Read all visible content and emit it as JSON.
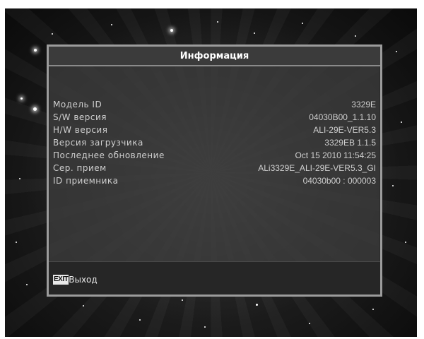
{
  "dialog": {
    "title": "Информация",
    "rows": [
      {
        "label": "Модель ID",
        "value": "3329E"
      },
      {
        "label": "S/W версия",
        "value": "04030B00_1.1.10"
      },
      {
        "label": "H/W версия",
        "value": "ALI-29E-VER5.3"
      },
      {
        "label": "Версия загрузчика",
        "value": "3329EB 1.1.5"
      },
      {
        "label": "Последнее обновление",
        "value": "Oct 15 2010 11:54:25"
      },
      {
        "label": "Сер. прием",
        "value": "ALi3329E_ALI-29E-VER5.3_GI"
      },
      {
        "label": "ID приемника",
        "value": "04030b00 : 000003"
      }
    ]
  },
  "footer": {
    "exit_key": "EXIT",
    "exit_label": "Выход"
  },
  "colors": {
    "panel_border": "#9c9c9c",
    "text": "#cfcfcf",
    "title": "#ffffff"
  }
}
